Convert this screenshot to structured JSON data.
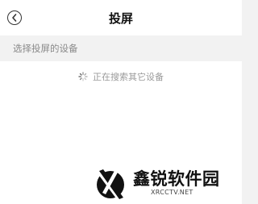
{
  "header": {
    "title": "投屏",
    "back_icon": "chevron-left-icon"
  },
  "section": {
    "label": "选择投屏的设备"
  },
  "status": {
    "text": "正在搜索其它设备",
    "icon": "spinner-icon"
  },
  "watermark": {
    "name": "鑫锐软件园",
    "url": "XRCCTV.NET"
  }
}
